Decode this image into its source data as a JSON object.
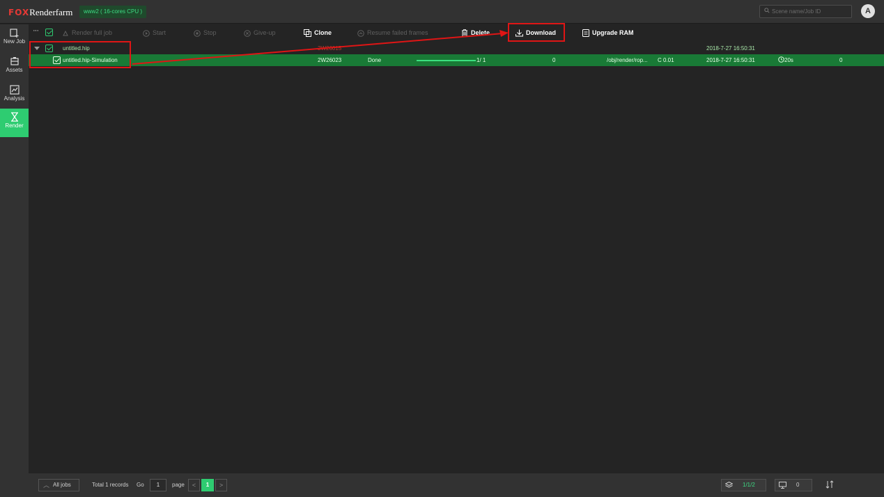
{
  "app": {
    "brand_prefix": "FOX",
    "brand_name": "Renderfarm",
    "server": "www2 ( 16-cores CPU )",
    "avatar_letter": "A"
  },
  "search": {
    "placeholder": "Scene name/Job ID",
    "icon": "search-icon"
  },
  "sidebar": {
    "items": [
      {
        "label": "New Job",
        "icon": "new-job-icon",
        "active": false
      },
      {
        "label": "Assets",
        "icon": "assets-icon",
        "active": false
      },
      {
        "label": "Analysis",
        "icon": "analysis-icon",
        "active": false
      },
      {
        "label": "Render",
        "icon": "hourglass-icon",
        "active": true
      }
    ]
  },
  "toolbar": {
    "more": "···",
    "render_full_job": "Render full job",
    "start": "Start",
    "stop": "Stop",
    "give_up": "Give-up",
    "clone": "Clone",
    "resume_failed": "Resume failed frames",
    "delete": "Delete",
    "download": "Download",
    "upgrade_ram": "Upgrade RAM"
  },
  "jobs": [
    {
      "name": "untitled.hip",
      "job_id": "2W26015",
      "submit_time": "2018-7-27 16:50:31",
      "expanded": true
    },
    {
      "name": "untitled.hip-Simulation",
      "job_id": "2W26023",
      "status": "Done",
      "progress": 1.0,
      "frames": "1/ 1",
      "failed": "0",
      "rop": "/obj/render/rop...",
      "cost": "C 0.01",
      "submit_time": "2018-7-27 16:50:31",
      "render_time": "20s",
      "extra": "0"
    }
  ],
  "footer": {
    "all_jobs": "All jobs",
    "total": "Total 1 records",
    "go": "Go",
    "go_value": "1",
    "page": "page",
    "current_page": "1",
    "prev": "<",
    "next": ">",
    "jobs_stat": "1/1/2",
    "machines_stat": "0"
  },
  "colors": {
    "accent": "#2ecc71",
    "annotation": "#e01515",
    "row_selected": "#197a36"
  }
}
